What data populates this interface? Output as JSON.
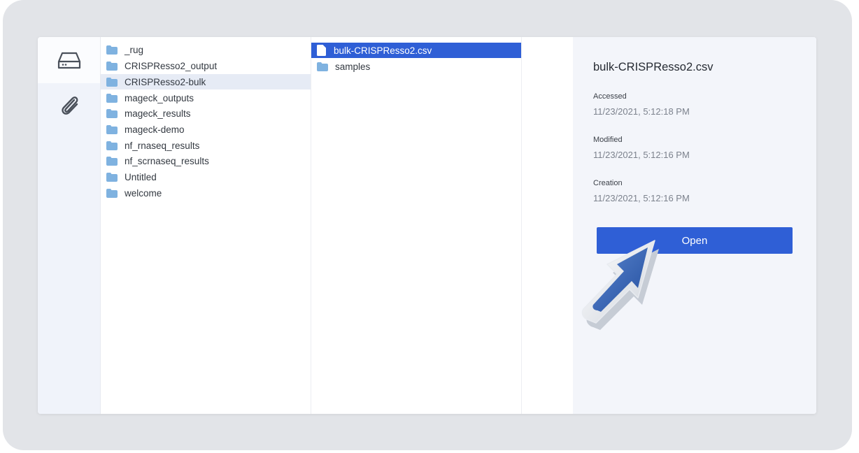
{
  "sidebar": {
    "items": [
      {
        "icon": "drive-icon",
        "active": true
      },
      {
        "icon": "paperclip-icon",
        "active": false
      }
    ]
  },
  "column1": {
    "items": [
      {
        "label": "_rug",
        "type": "folder"
      },
      {
        "label": "CRISPResso2_output",
        "type": "folder"
      },
      {
        "label": "CRISPResso2-bulk",
        "type": "folder",
        "highlighted": true
      },
      {
        "label": "mageck_outputs",
        "type": "folder"
      },
      {
        "label": "mageck_results",
        "type": "folder"
      },
      {
        "label": "mageck-demo",
        "type": "folder"
      },
      {
        "label": "nf_rnaseq_results",
        "type": "folder"
      },
      {
        "label": "nf_scrnaseq_results",
        "type": "folder"
      },
      {
        "label": "Untitled",
        "type": "folder"
      },
      {
        "label": "welcome",
        "type": "folder"
      }
    ]
  },
  "column2": {
    "items": [
      {
        "label": "bulk-CRISPResso2.csv",
        "type": "file",
        "selected": true
      },
      {
        "label": "samples",
        "type": "folder"
      }
    ]
  },
  "details": {
    "title": "bulk-CRISPResso2.csv",
    "accessed_label": "Accessed",
    "accessed_value": "11/23/2021, 5:12:18 PM",
    "modified_label": "Modified",
    "modified_value": "11/23/2021, 5:12:16 PM",
    "creation_label": "Creation",
    "creation_value": "11/23/2021, 5:12:16 PM",
    "open_label": "Open"
  },
  "colors": {
    "accent": "#2f5fd6",
    "folder": "#7fb2e0",
    "highlight_row": "#e6ebf5",
    "detail_bg": "#f3f5fa"
  }
}
